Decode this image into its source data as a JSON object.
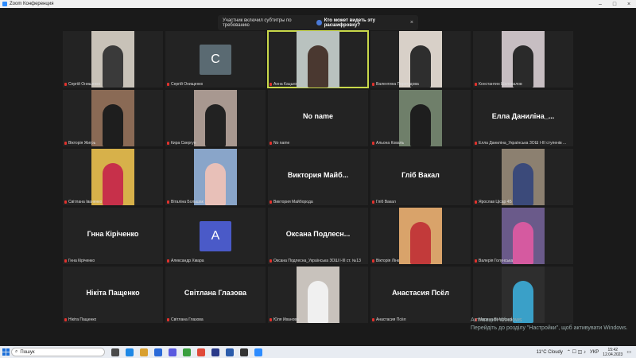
{
  "window": {
    "title": "Zoom Конференция"
  },
  "banner": {
    "message": "Участник включил субтитры по требованию",
    "question": "Кто может видеть эту расшифровку?",
    "close": "×"
  },
  "tiles": [
    {
      "label": "Сергій Онищенко",
      "type": "video",
      "bg": "#c8c2b8",
      "person": "#3a3a3a"
    },
    {
      "label": "Сергій Онищенко",
      "type": "avatar",
      "initial": "C",
      "avatar_color": "#5a6a72"
    },
    {
      "label": "Анна Кацько",
      "type": "video",
      "bg": "#b9c2bf",
      "person": "#4a3830",
      "active": true
    },
    {
      "label": "Валентина Перегудова",
      "type": "video",
      "bg": "#d8d0c8",
      "person": "#2e2e2e"
    },
    {
      "label": "Константин Шаповалов",
      "type": "video",
      "bg": "#c7bec2",
      "person": "#2a2a2a"
    },
    {
      "label": "Вікторія Жигрь",
      "type": "video",
      "bg": "#8a6a55",
      "person": "#1e1e1e"
    },
    {
      "label": "Кира Свергун",
      "type": "video",
      "bg": "#a89890",
      "person": "#222"
    },
    {
      "label": "No name",
      "type": "name",
      "big": "No name"
    },
    {
      "label": "Альона Коваль",
      "type": "video",
      "bg": "#6f7f6a",
      "person": "#1e1e1e"
    },
    {
      "label": "Елла Даниліна_Українська ЗОШ І-ІІІ ступенів ...",
      "type": "name",
      "big": "Елла Даниліна_..."
    },
    {
      "label": "Світлана Іваненко",
      "type": "video",
      "bg": "#d7b14a",
      "person": "#c7304a"
    },
    {
      "label": "Віталіна Большак",
      "type": "video",
      "bg": "#89a5c9",
      "person": "#e8c0b8"
    },
    {
      "label": "Виктория Майборода",
      "type": "name",
      "big": "Виктория Майб..."
    },
    {
      "label": "Гліб Вакал",
      "type": "name",
      "big": "Гліб Вакал"
    },
    {
      "label": "Ярослав Цісар 4Б",
      "type": "video",
      "bg": "#8c8070",
      "person": "#3b4a7a"
    },
    {
      "label": "Гнна Кіріченко",
      "type": "name",
      "big": "Гнна Кіріченко"
    },
    {
      "label": "Александр Хмара",
      "type": "avatar",
      "initial": "A",
      "avatar_color": "#4a5ac8"
    },
    {
      "label": "Оксана Подлесна_Українська ЗОШ І-ІІІ ст. №13",
      "type": "name",
      "big": "Оксана Подлесн..."
    },
    {
      "label": "Вікторія Лінк",
      "type": "video",
      "bg": "#d9a36a",
      "person": "#c23a3a"
    },
    {
      "label": "Валерія Голунська",
      "type": "video",
      "bg": "#6a5a8a",
      "person": "#d55aa0"
    },
    {
      "label": "Нікіта Пащенко",
      "type": "name",
      "big": "Нікіта Пащенко"
    },
    {
      "label": "Світлана Глазова",
      "type": "name",
      "big": "Світлана Глазова"
    },
    {
      "label": "Юля Иванова",
      "type": "video",
      "bg": "#c8c2bc",
      "person": "#f0f0f0"
    },
    {
      "label": "Анастасия Псёл",
      "type": "name",
      "big": "Анастасия Псёл"
    },
    {
      "label": "Марина Вінарська",
      "type": "video",
      "bg": "#2e2e2e",
      "person": "#3aa0c8"
    }
  ],
  "watermark": {
    "line1": "Активация Windows",
    "line2": "Перейдіть до розділу \"Настройки\", щоб активувати Windows."
  },
  "taskbar": {
    "search_placeholder": "Пошук",
    "weather": "11°C  Cloudy",
    "lang": "УКР",
    "time": "15:42",
    "date": "12.04.2023"
  }
}
